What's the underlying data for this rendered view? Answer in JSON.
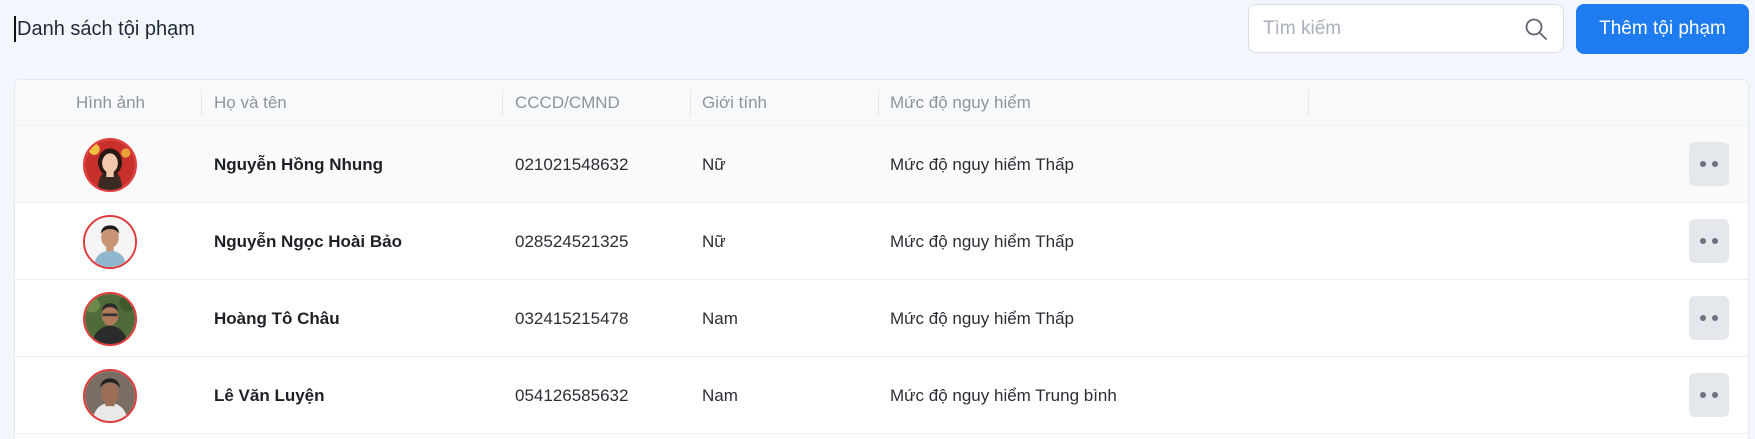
{
  "header": {
    "title": "Danh sách tội phạm",
    "search_placeholder": "Tìm kiếm",
    "add_button_label": "Thêm tội phạm"
  },
  "colors": {
    "primary": "#1f7bf0",
    "avatar_border": "#e03b3b",
    "background": "#f3f7fd"
  },
  "table": {
    "columns": [
      "Hình ảnh",
      "Họ và tên",
      "CCCD/CMND",
      "Giới tính",
      "Mức độ nguy hiểm"
    ],
    "rows": [
      {
        "name": "Nguyễn Hồng Nhung",
        "id": "021021548632",
        "gender": "Nữ",
        "danger": "Mức độ nguy hiểm Thấp"
      },
      {
        "name": "Nguyễn Ngọc Hoài Bảo",
        "id": "028524521325",
        "gender": "Nữ",
        "danger": "Mức độ nguy hiểm Thấp"
      },
      {
        "name": "Hoàng Tô Châu",
        "id": "032415215478",
        "gender": "Nam",
        "danger": "Mức độ nguy hiểm Thấp"
      },
      {
        "name": "Lê Văn Luyện",
        "id": "054126585632",
        "gender": "Nam",
        "danger": "Mức độ nguy hiểm Trung bình"
      }
    ]
  }
}
